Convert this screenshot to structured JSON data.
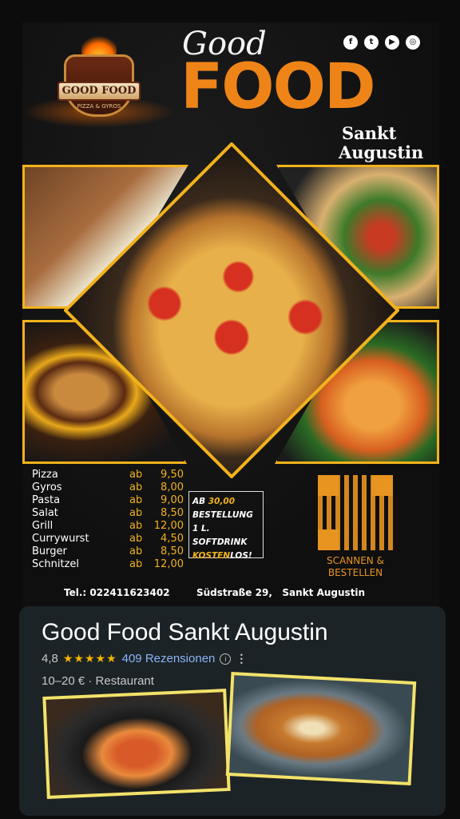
{
  "poster": {
    "brand_logo_text": "GOOD FOOD",
    "brand_logo_sub": "PIZZA & GYROS",
    "title_script": "Good",
    "title_main": "FOOD",
    "city_line1": "Sankt",
    "city_line2": "Augustin",
    "social_icons": [
      "facebook-icon",
      "twitter-icon",
      "youtube-icon",
      "instagram-icon"
    ],
    "menu": [
      {
        "name": "Pizza",
        "ab": "ab",
        "price": "9,50"
      },
      {
        "name": "Gyros",
        "ab": "ab",
        "price": "8,00"
      },
      {
        "name": "Pasta",
        "ab": "ab",
        "price": "9,00"
      },
      {
        "name": "Salat",
        "ab": "ab",
        "price": "8,50"
      },
      {
        "name": "Grill",
        "ab": "ab",
        "price": "12,00"
      },
      {
        "name": "Currywurst",
        "ab": "ab",
        "price": "4,50"
      },
      {
        "name": "Burger",
        "ab": "ab",
        "price": "8,50"
      },
      {
        "name": "Schnitzel",
        "ab": "ab",
        "price": "12,00"
      }
    ],
    "promo": {
      "line1_prefix": "AB ",
      "line1_highlight": "30,00",
      "line2": "BESTELLUNG",
      "line3": "1 L. SOFTDRINK",
      "line4_highlight": "KOSTEN",
      "line4_suffix": "LOS!"
    },
    "qr_label_line1": "SCANNEN &",
    "qr_label_line2": "BESTELLEN",
    "phone": "Tel.: 022411623402",
    "address": "Südstraße 29,   Sankt Augustin",
    "accent_color": "#f2b21c",
    "title_color": "#ee8418"
  },
  "listing": {
    "name": "Good Food Sankt Augustin",
    "rating": "4,8",
    "stars": "★★★★★",
    "reviews": "409 Rezensionen",
    "info_icon": "i",
    "more_icon": "⋮",
    "price_category": "10–20 € · Restaurant"
  }
}
